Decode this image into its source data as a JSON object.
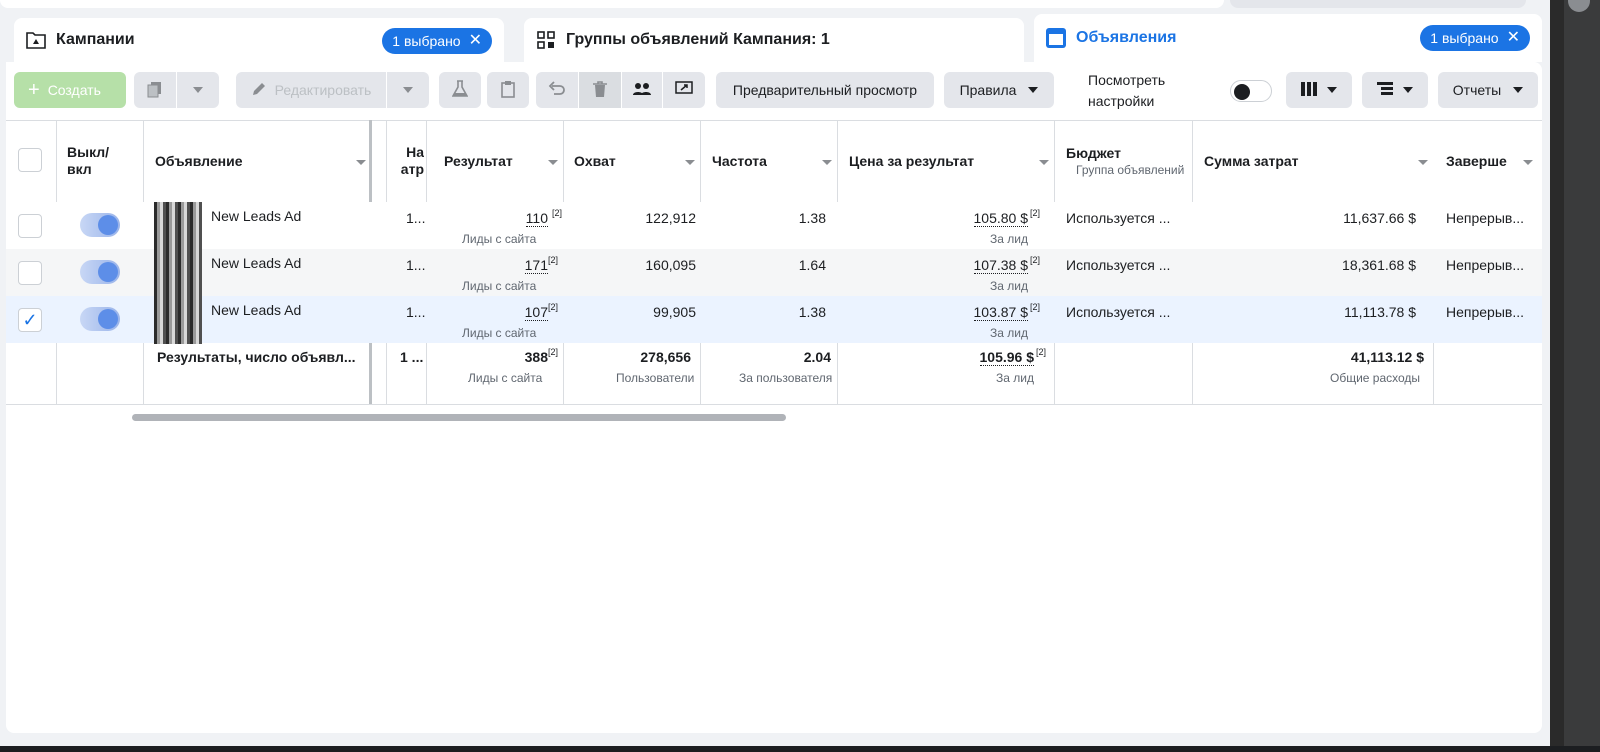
{
  "tabs": {
    "campaigns": {
      "label": "Кампании",
      "badge": "1 выбрано",
      "icon": "folder-icon"
    },
    "adsets": {
      "label": "Группы объявлений Кампания: 1",
      "icon": "grid-icon"
    },
    "ads": {
      "label": "Объявления",
      "badge": "1 выбрано",
      "icon": "ad-icon"
    }
  },
  "toolbar": {
    "create": "Создать",
    "edit": "Редактировать",
    "preview": "Предварительный просмотр",
    "rules": "Правила",
    "view_settings_line1": "Посмотреть",
    "view_settings_line2": "настройки",
    "reports": "Отчеты"
  },
  "columns": {
    "onoff_1": "Выкл/",
    "onoff_2": "вкл",
    "ad": "Объявление",
    "attr_1": "На",
    "attr_2": "атр",
    "result": "Результат",
    "reach": "Охват",
    "frequency": "Частота",
    "cost_per_result": "Цена за результат",
    "budget": "Бюджет",
    "budget_sub": "Группа объявлений",
    "amount_spent": "Сумма затрат",
    "ends": "Заверше"
  },
  "rows": [
    {
      "name": "New Leads Ad",
      "attr": "1...",
      "result": "110",
      "result_sup": "[2]",
      "result_sub": "Лиды с сайта",
      "reach": "122,912",
      "frequency": "1.38",
      "cpr": "105.80 $",
      "cpr_sup": "[2]",
      "cpr_sub": "За лид",
      "budget": "Используется ...",
      "spent": "11,637.66 $",
      "ends": "Непрерыв...",
      "checked": false
    },
    {
      "name": "New Leads Ad",
      "attr": "1...",
      "result": "171",
      "result_sup": "[2]",
      "result_sub": "Лиды с сайта",
      "reach": "160,095",
      "frequency": "1.64",
      "cpr": "107.38 $",
      "cpr_sup": "[2]",
      "cpr_sub": "За лид",
      "budget": "Используется ...",
      "spent": "18,361.68 $",
      "ends": "Непрерыв...",
      "checked": false
    },
    {
      "name": "New Leads Ad",
      "attr": "1...",
      "result": "107",
      "result_sup": "[2]",
      "result_sub": "Лиды с сайта",
      "reach": "99,905",
      "frequency": "1.38",
      "cpr": "103.87 $",
      "cpr_sup": "[2]",
      "cpr_sub": "За лид",
      "budget": "Используется ...",
      "spent": "11,113.78 $",
      "ends": "Непрерыв...",
      "checked": true
    }
  ],
  "totals": {
    "label": "Результаты, число объявл...",
    "attr": "1 ...",
    "result": "388",
    "result_sup": "[2]",
    "result_sub": "Лиды с сайта",
    "reach": "278,656",
    "reach_sub": "Пользователи",
    "frequency": "2.04",
    "frequency_sub": "За пользователя",
    "cpr": "105.96 $",
    "cpr_sup": "[2]",
    "cpr_sub": "За лид",
    "spent": "41,113.12 $",
    "spent_sub": "Общие расходы"
  },
  "colors": {
    "accent": "#1b74e4",
    "create_disabled": "#b6e0a8",
    "selected_row": "#ebf3ff"
  }
}
